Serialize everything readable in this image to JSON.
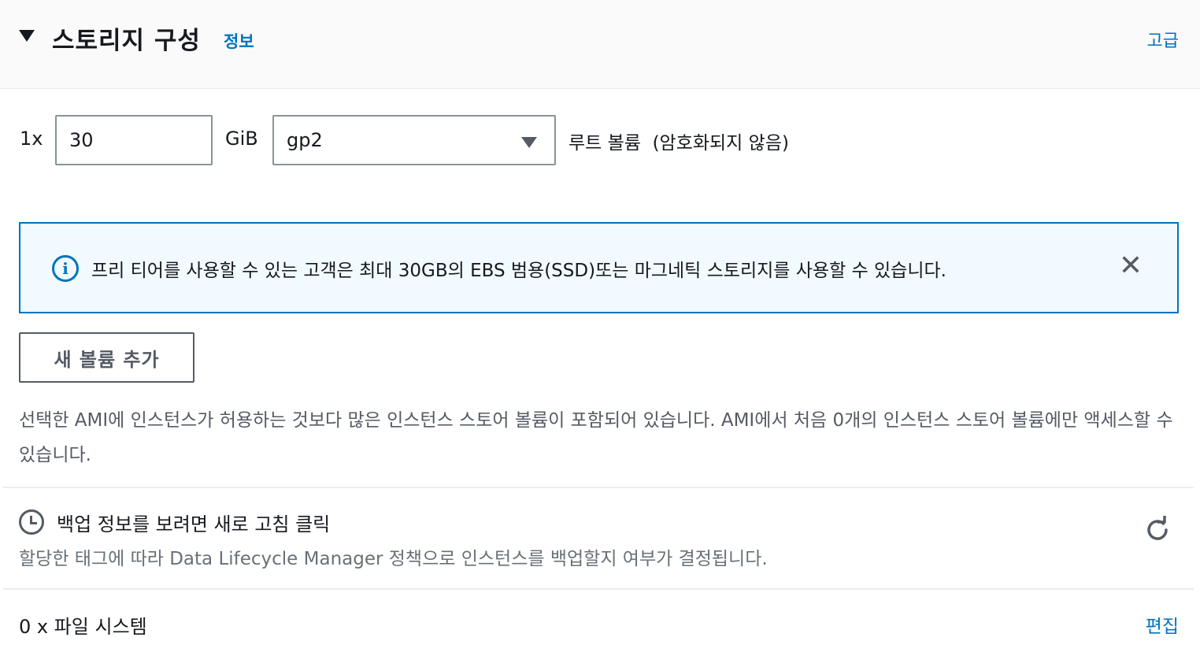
{
  "header": {
    "title": "스토리지 구성",
    "info_link": "정보",
    "advanced_link": "고급"
  },
  "volume": {
    "multiplier": "1x",
    "size_value": "30",
    "unit": "GiB",
    "type_selected": "gp2",
    "root_label": "루트 볼륨  (암호화되지 않음)"
  },
  "alert": {
    "text": "프리 티어를 사용할 수 있는 고객은 최대 30GB의 EBS 범용(SSD)또는 마그네틱 스토리지를 사용할 수 있습니다."
  },
  "add_volume_button": "새 볼륨 추가",
  "instance_store_note": "선택한 AMI에 인스턴스가 허용하는 것보다 많은 인스턴스 스토어 볼륨이 포함되어 있습니다. AMI에서 처음 0개의 인스턴스 스토어 볼륨에만 액세스할 수 있습니다.",
  "backup": {
    "title": "백업 정보를 보려면 새로 고침 클릭",
    "description": "할당한 태그에 따라 Data Lifecycle Manager 정책으로 인스턴스를 백업할지 여부가 결정됩니다."
  },
  "file_systems": {
    "label": "0 x 파일 시스템",
    "edit_link": "편집"
  },
  "colors": {
    "link": "#0073bb",
    "alert_bg": "#f1faff",
    "text": "#16191f",
    "muted": "#545b64"
  },
  "icons": {
    "collapse": "caret-down-icon",
    "info": "info-circle-icon",
    "close": "close-icon",
    "clock": "clock-icon",
    "refresh": "refresh-icon",
    "select": "chevron-down-icon"
  }
}
